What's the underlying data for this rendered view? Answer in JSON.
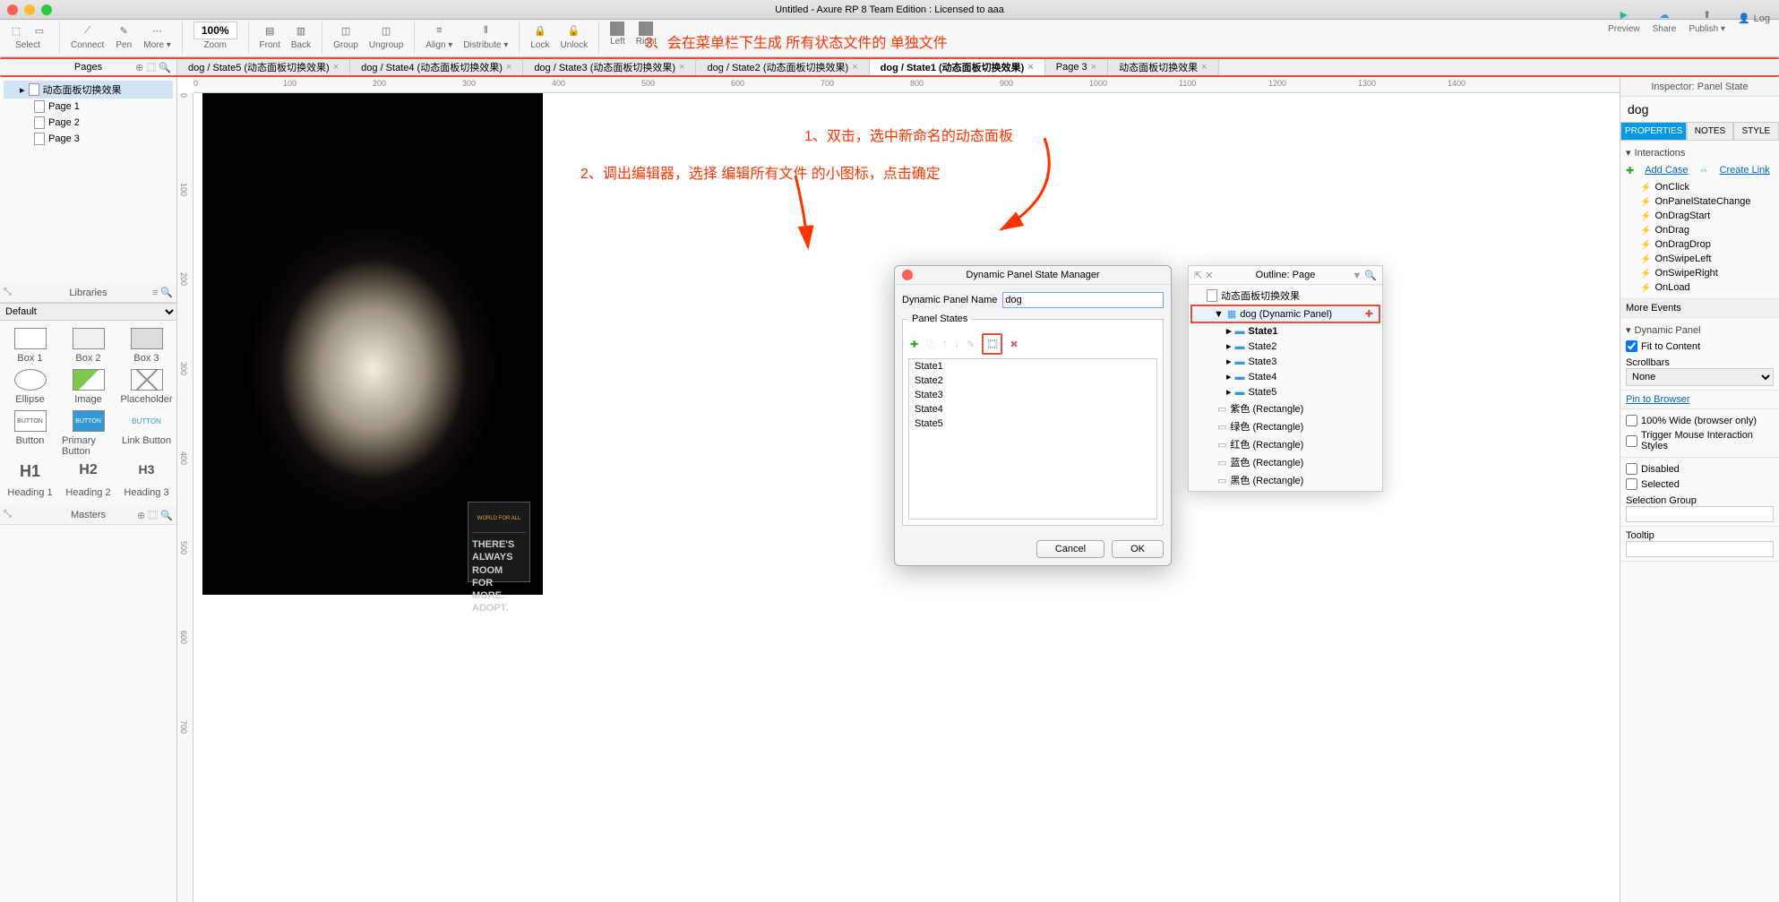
{
  "title": "Untitled - Axure RP 8 Team Edition : Licensed to aaa",
  "user": "Log",
  "toolbar": {
    "select": "Select",
    "connect": "Connect",
    "pen": "Pen",
    "more": "More ▾",
    "zoom_value": "100%",
    "zoom_label": "Zoom",
    "front": "Front",
    "back": "Back",
    "group": "Group",
    "ungroup": "Ungroup",
    "align": "Align ▾",
    "distribute": "Distribute ▾",
    "lock": "Lock",
    "unlock": "Unlock",
    "left": "Left",
    "right": "Right",
    "preview": "Preview",
    "share": "Share",
    "publish": "Publish ▾"
  },
  "annotations": {
    "a1": "1、双击，选中新命名的动态面板",
    "a2": "2、调出编辑器，选择 编辑所有文件 的小图标，点击确定",
    "a3": "3、会在菜单栏下生成  所有状态文件的  单独文件"
  },
  "tabs": [
    {
      "label": "dog / State5 (动态面板切换效果)",
      "closable": true
    },
    {
      "label": "dog / State4 (动态面板切换效果)",
      "closable": true
    },
    {
      "label": "dog / State3 (动态面板切换效果)",
      "closable": true
    },
    {
      "label": "dog / State2 (动态面板切换效果)",
      "closable": true
    },
    {
      "label": "dog / State1 (动态面板切换效果)",
      "closable": true,
      "active": true
    },
    {
      "label": "Page 3",
      "closable": true
    },
    {
      "label": "动态面板切换效果",
      "closable": true
    }
  ],
  "pages": {
    "header": "Pages",
    "items": [
      "动态面板切换效果",
      "Page 1",
      "Page 2",
      "Page 3"
    ]
  },
  "libraries": {
    "header": "Libraries",
    "dropdown": "Default",
    "items": [
      "Box 1",
      "Box 2",
      "Box 3",
      "Ellipse",
      "Image",
      "Placeholder",
      "Button",
      "Primary Button",
      "Link Button",
      "Heading 1",
      "Heading 2",
      "Heading 3"
    ],
    "h1": "H1",
    "h2": "H2",
    "h3": "H3",
    "btn": "BUTTON"
  },
  "masters": {
    "header": "Masters"
  },
  "ruler_ticks": [
    "0",
    "100",
    "200",
    "300",
    "400",
    "500",
    "600",
    "700",
    "800",
    "900",
    "1000",
    "1100",
    "1200",
    "1300",
    "1400"
  ],
  "ruler_v": [
    "0",
    "100",
    "200",
    "300",
    "400",
    "500",
    "600",
    "700"
  ],
  "dialog": {
    "title": "Dynamic Panel State Manager",
    "name_label": "Dynamic Panel Name",
    "name_value": "dog",
    "states_label": "Panel States",
    "states": [
      "State1",
      "State2",
      "State3",
      "State4",
      "State5"
    ],
    "cancel": "Cancel",
    "ok": "OK"
  },
  "outline": {
    "title": "Outline: Page",
    "root": "动态面板切换效果",
    "dp": "dog (Dynamic Panel)",
    "states": [
      "State1",
      "State2",
      "State3",
      "State4",
      "State5"
    ],
    "shapes": [
      "紫色 (Rectangle)",
      "绿色 (Rectangle)",
      "红色 (Rectangle)",
      "蓝色 (Rectangle)",
      "黑色 (Rectangle)"
    ]
  },
  "inspector": {
    "header": "Inspector: Panel State",
    "name": "dog",
    "tabs": [
      "PROPERTIES",
      "NOTES",
      "STYLE"
    ],
    "interactions": "Interactions",
    "add_case": "Add Case",
    "create_link": "Create Link",
    "events": [
      "OnClick",
      "OnPanelStateChange",
      "OnDragStart",
      "OnDrag",
      "OnDragDrop",
      "OnSwipeLeft",
      "OnSwipeRight",
      "OnLoad"
    ],
    "more_events": "More Events",
    "dp_section": "Dynamic Panel",
    "fit": "Fit to Content",
    "scrollbars": "Scrollbars",
    "scrollbars_val": "None",
    "pin": "Pin to Browser",
    "wide": "100% Wide (browser only)",
    "trigger": "Trigger Mouse Interaction Styles",
    "disabled": "Disabled",
    "selected": "Selected",
    "selgroup": "Selection Group",
    "tooltip": "Tooltip"
  },
  "poster": {
    "line1": "THERE'S",
    "line2": "ALWAYS ROOM",
    "line3": "FOR MORE.",
    "line4": "ADOPT.",
    "brand": "WORLD FOR ALL"
  }
}
